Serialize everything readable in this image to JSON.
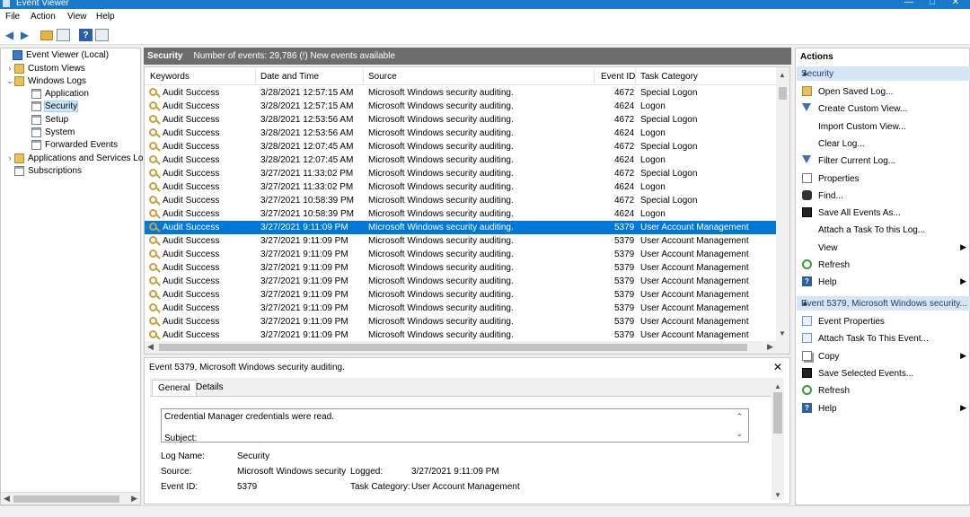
{
  "window": {
    "title": "Event Viewer",
    "controls": [
      "—",
      "□",
      "✕"
    ]
  },
  "menu": [
    "File",
    "Action",
    "View",
    "Help"
  ],
  "tree": {
    "items": [
      {
        "label": "Event Viewer (Local)",
        "expander": "",
        "icon": "computer-icon",
        "level": 0
      },
      {
        "label": "Custom Views",
        "expander": "›",
        "icon": "folder-icon",
        "level": 1
      },
      {
        "label": "Windows Logs",
        "expander": "⌄",
        "icon": "folder-icon",
        "level": 1
      },
      {
        "label": "Application",
        "expander": "",
        "icon": "log-icon",
        "level": 2
      },
      {
        "label": "Security",
        "expander": "",
        "icon": "log-icon",
        "level": 2,
        "selected": true
      },
      {
        "label": "Setup",
        "expander": "",
        "icon": "log-icon",
        "level": 2
      },
      {
        "label": "System",
        "expander": "",
        "icon": "log-icon",
        "level": 2
      },
      {
        "label": "Forwarded Events",
        "expander": "",
        "icon": "log-icon",
        "level": 2
      },
      {
        "label": "Applications and Services Lo",
        "expander": "›",
        "icon": "folder-icon",
        "level": 1
      },
      {
        "label": "Subscriptions",
        "expander": "",
        "icon": "log-icon",
        "level": 1
      }
    ]
  },
  "log": {
    "name": "Security",
    "count_text": "Number of events: 29,786 (!) New events available"
  },
  "grid": {
    "columns": [
      "Keywords",
      "Date and Time",
      "Source",
      "Event ID",
      "Task Category"
    ],
    "rows": [
      [
        "Audit Success",
        "3/28/2021 12:57:15 AM",
        "Microsoft Windows security auditing.",
        "4672",
        "Special Logon"
      ],
      [
        "Audit Success",
        "3/28/2021 12:57:15 AM",
        "Microsoft Windows security auditing.",
        "4624",
        "Logon"
      ],
      [
        "Audit Success",
        "3/28/2021 12:53:56 AM",
        "Microsoft Windows security auditing.",
        "4672",
        "Special Logon"
      ],
      [
        "Audit Success",
        "3/28/2021 12:53:56 AM",
        "Microsoft Windows security auditing.",
        "4624",
        "Logon"
      ],
      [
        "Audit Success",
        "3/28/2021 12:07:45 AM",
        "Microsoft Windows security auditing.",
        "4672",
        "Special Logon"
      ],
      [
        "Audit Success",
        "3/28/2021 12:07:45 AM",
        "Microsoft Windows security auditing.",
        "4624",
        "Logon"
      ],
      [
        "Audit Success",
        "3/27/2021 11:33:02 PM",
        "Microsoft Windows security auditing.",
        "4672",
        "Special Logon"
      ],
      [
        "Audit Success",
        "3/27/2021 11:33:02 PM",
        "Microsoft Windows security auditing.",
        "4624",
        "Logon"
      ],
      [
        "Audit Success",
        "3/27/2021 10:58:39 PM",
        "Microsoft Windows security auditing.",
        "4672",
        "Special Logon"
      ],
      [
        "Audit Success",
        "3/27/2021 10:58:39 PM",
        "Microsoft Windows security auditing.",
        "4624",
        "Logon"
      ],
      [
        "Audit Success",
        "3/27/2021 9:11:09 PM",
        "Microsoft Windows security auditing.",
        "5379",
        "User Account Management"
      ],
      [
        "Audit Success",
        "3/27/2021 9:11:09 PM",
        "Microsoft Windows security auditing.",
        "5379",
        "User Account Management"
      ],
      [
        "Audit Success",
        "3/27/2021 9:11:09 PM",
        "Microsoft Windows security auditing.",
        "5379",
        "User Account Management"
      ],
      [
        "Audit Success",
        "3/27/2021 9:11:09 PM",
        "Microsoft Windows security auditing.",
        "5379",
        "User Account Management"
      ],
      [
        "Audit Success",
        "3/27/2021 9:11:09 PM",
        "Microsoft Windows security auditing.",
        "5379",
        "User Account Management"
      ],
      [
        "Audit Success",
        "3/27/2021 9:11:09 PM",
        "Microsoft Windows security auditing.",
        "5379",
        "User Account Management"
      ],
      [
        "Audit Success",
        "3/27/2021 9:11:09 PM",
        "Microsoft Windows security auditing.",
        "5379",
        "User Account Management"
      ],
      [
        "Audit Success",
        "3/27/2021 9:11:09 PM",
        "Microsoft Windows security auditing.",
        "5379",
        "User Account Management"
      ],
      [
        "Audit Success",
        "3/27/2021 9:11:09 PM",
        "Microsoft Windows security auditing.",
        "5379",
        "User Account Management"
      ]
    ],
    "selected_row": 10
  },
  "detail": {
    "title": "Event 5379, Microsoft Windows security auditing.",
    "close": "✕",
    "tabs": [
      "General",
      "Details"
    ],
    "description_line1": "Credential Manager credentials were read.",
    "description_line2": "Subject:",
    "fields": {
      "log_name_label": "Log Name:",
      "log_name": "Security",
      "source_label": "Source:",
      "source": "Microsoft Windows security",
      "logged_label": "Logged:",
      "logged": "3/27/2021 9:11:09 PM",
      "event_id_label": "Event ID:",
      "event_id": "5379",
      "task_category_label": "Task Category:",
      "task_category": "User Account Management"
    }
  },
  "actions": {
    "title": "Actions",
    "group1": "Security",
    "group1_items": [
      {
        "label": "Open Saved Log...",
        "icon": "open-log-icon",
        "submenu": false
      },
      {
        "label": "Create Custom View...",
        "icon": "filter-icon",
        "submenu": false
      },
      {
        "label": "Import Custom View...",
        "icon": "",
        "submenu": false
      },
      {
        "label": "Clear Log...",
        "icon": "",
        "submenu": false
      },
      {
        "label": "Filter Current Log...",
        "icon": "filter-icon",
        "submenu": false
      },
      {
        "label": "Properties",
        "icon": "properties-icon",
        "submenu": false
      },
      {
        "label": "Find...",
        "icon": "binoculars-icon",
        "submenu": false
      },
      {
        "label": "Save All Events As...",
        "icon": "save-icon",
        "submenu": false
      },
      {
        "label": "Attach a Task To this Log...",
        "icon": "",
        "submenu": false
      },
      {
        "label": "View",
        "icon": "",
        "submenu": true
      },
      {
        "label": "Refresh",
        "icon": "refresh-icon",
        "submenu": false
      },
      {
        "label": "Help",
        "icon": "help-icon",
        "submenu": true
      }
    ],
    "group2": "Event 5379, Microsoft Windows security...",
    "group2_items": [
      {
        "label": "Event Properties",
        "icon": "event-properties-icon",
        "submenu": false
      },
      {
        "label": "Attach Task To This Event...",
        "icon": "attach-task-icon",
        "submenu": false
      },
      {
        "label": "Copy",
        "icon": "copy-icon",
        "submenu": true
      },
      {
        "label": "Save Selected Events...",
        "icon": "save-icon",
        "submenu": false
      },
      {
        "label": "Refresh",
        "icon": "refresh-icon",
        "submenu": false
      },
      {
        "label": "Help",
        "icon": "help-icon",
        "submenu": true
      }
    ]
  },
  "colors": {
    "selection": "#0078d7",
    "titlebar": "#1979ca",
    "header": "#6d6d6d",
    "action_group": "#d6e4f4"
  }
}
